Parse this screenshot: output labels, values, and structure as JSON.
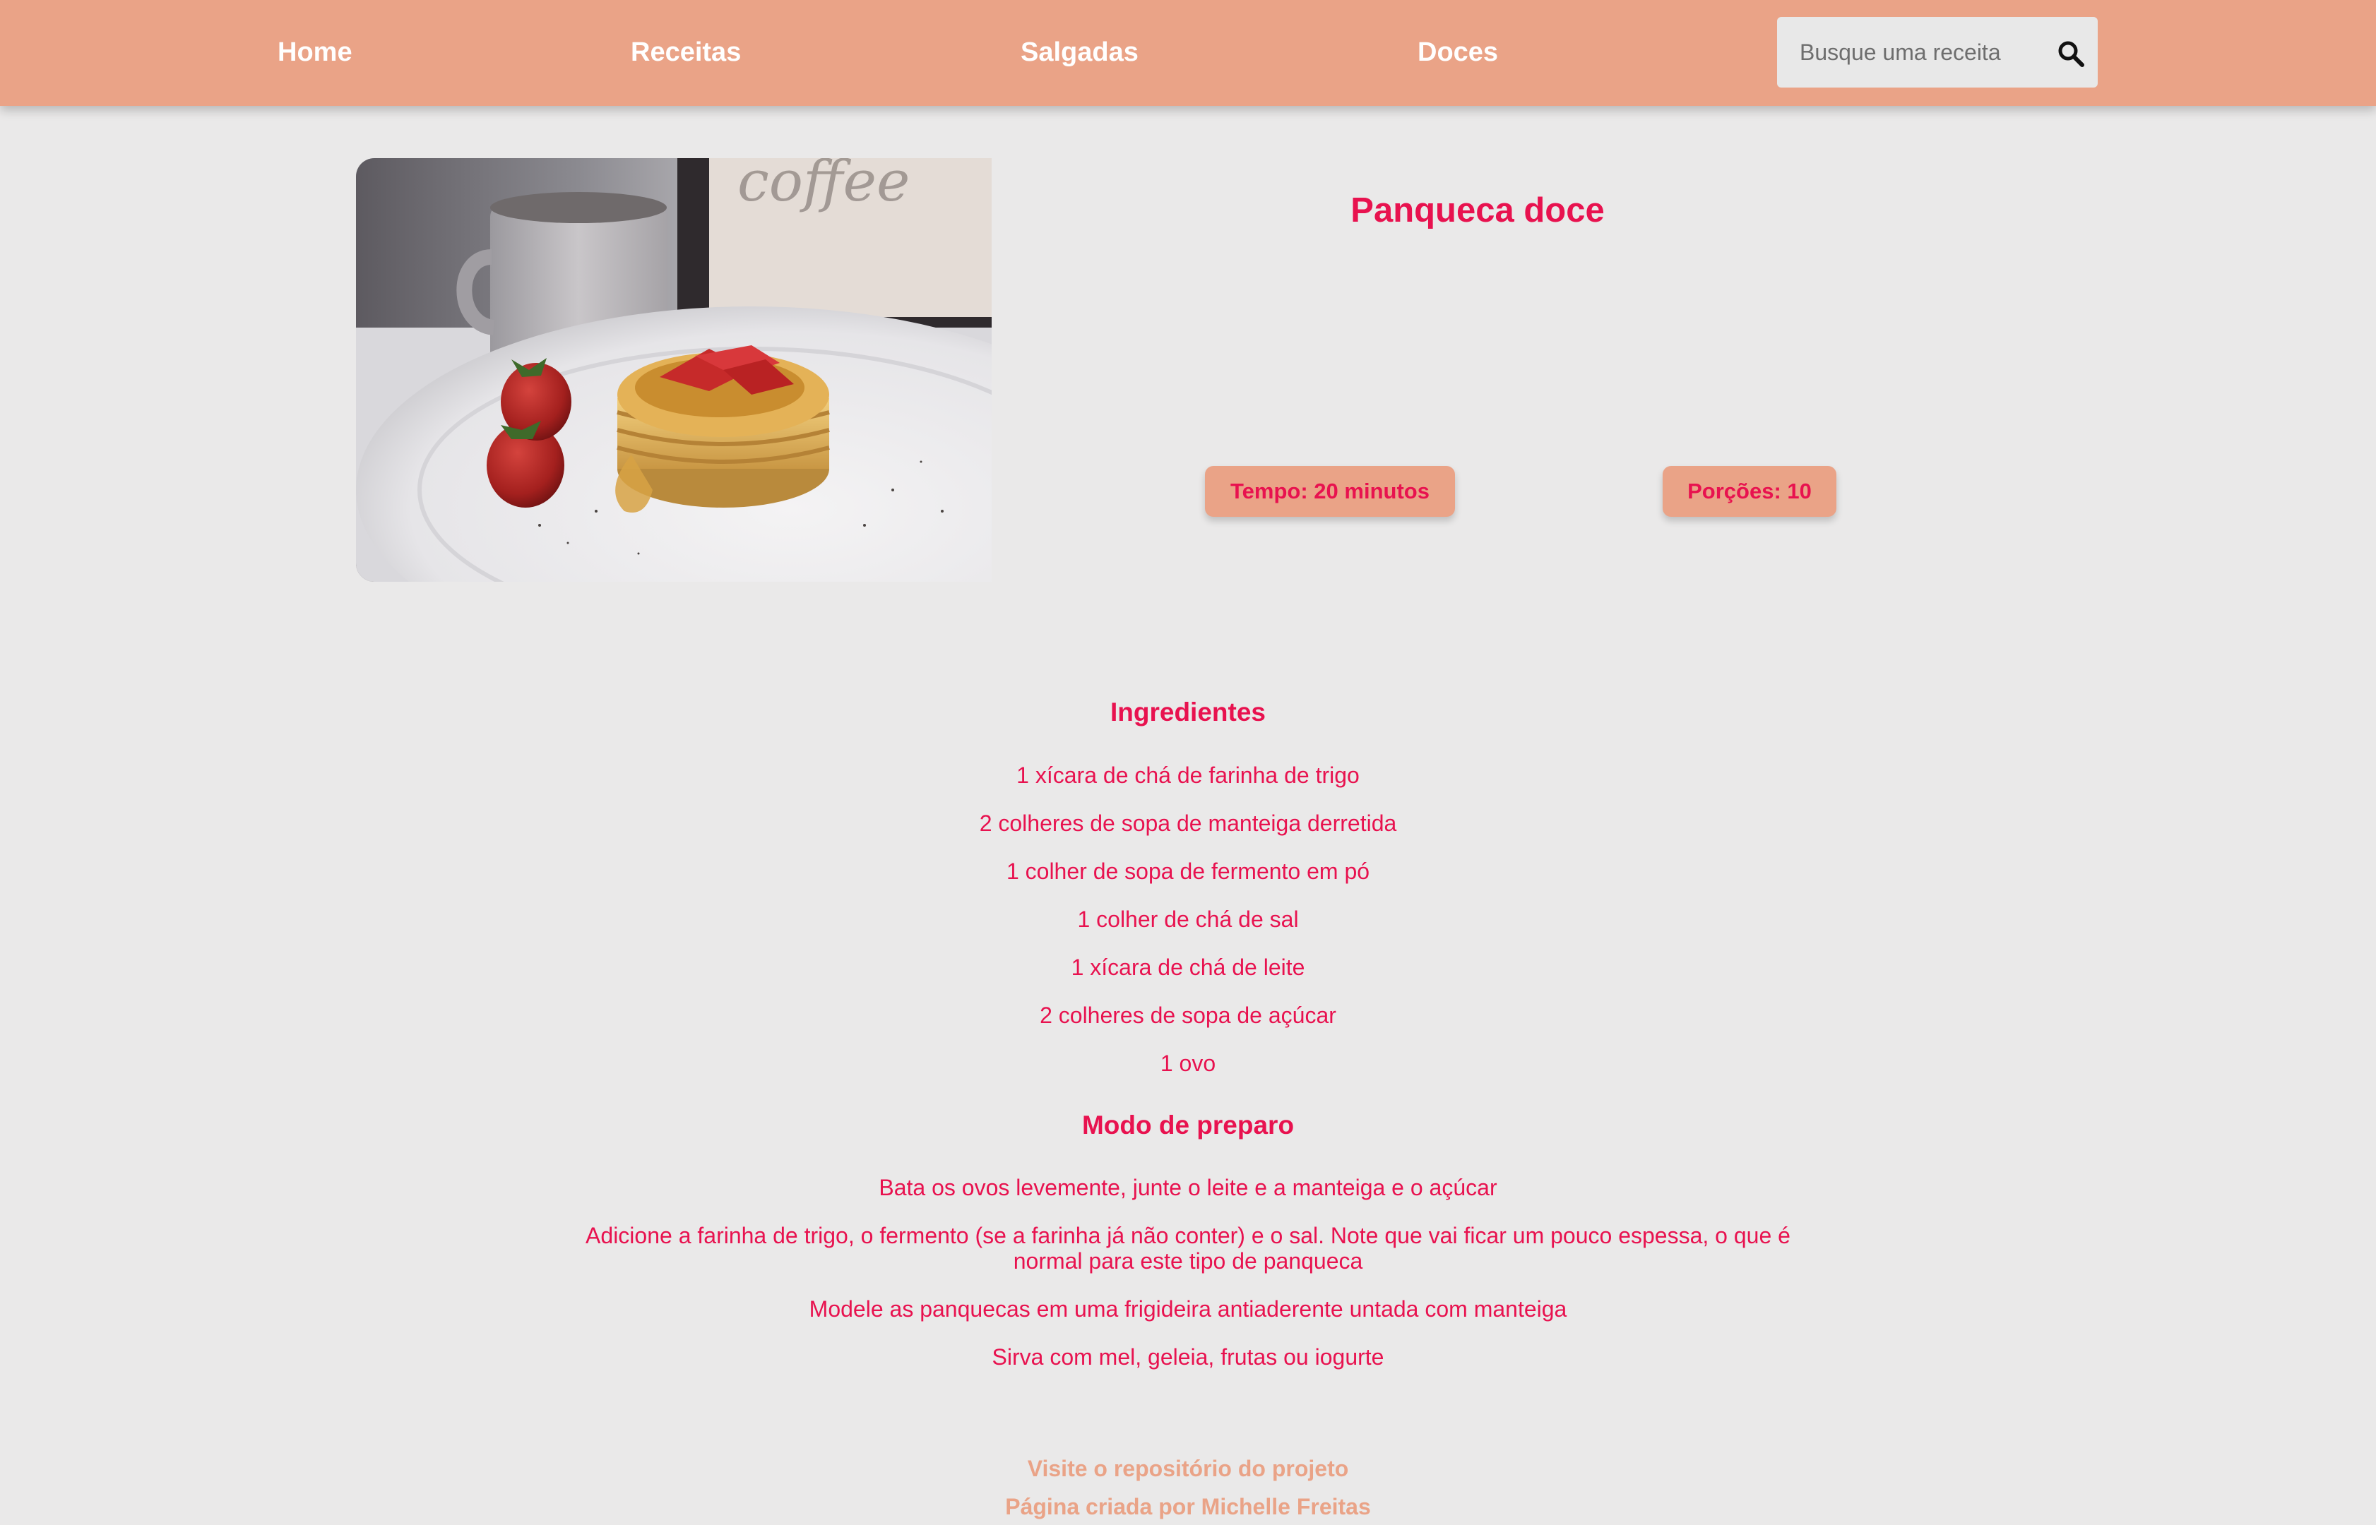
{
  "nav": {
    "home": "Home",
    "receitas": "Receitas",
    "salgadas": "Salgadas",
    "doces": "Doces"
  },
  "search": {
    "placeholder": "Busque uma receita",
    "value": "",
    "icon": "search-icon"
  },
  "recipe": {
    "title": "Panqueca doce",
    "tempo": "Tempo: 20 minutos",
    "porcoes": "Porções: 10",
    "image": "pancakes-with-strawberries-photo"
  },
  "ingredients": {
    "heading": "Ingredientes",
    "items": [
      "1 xícara de chá de farinha de trigo",
      "2 colheres de sopa de manteiga derretida",
      "1 colher de sopa de fermento em pó",
      "1 colher de chá de sal",
      "1 xícara de chá de leite",
      "2 colheres de sopa de açúcar",
      "1 ovo"
    ]
  },
  "preparation": {
    "heading": "Modo de preparo",
    "steps": [
      "Bata os ovos levemente, junte o leite e a manteiga e o açúcar",
      "Adicione a farinha de trigo, o fermento (se a farinha já não conter) e o sal. Note que vai ficar um pouco espessa, o que é normal para este tipo de panqueca",
      "Modele as panquecas em uma frigideira antiaderente untada com manteiga",
      "Sirva com mel, geleia, frutas ou iogurte"
    ]
  },
  "footer": {
    "repo_link": "Visite o repositório do projeto",
    "credit": "Página criada por Michelle Freitas"
  },
  "colors": {
    "header": "#eaa387",
    "accent": "#e8124f",
    "background": "#eae9e9"
  }
}
